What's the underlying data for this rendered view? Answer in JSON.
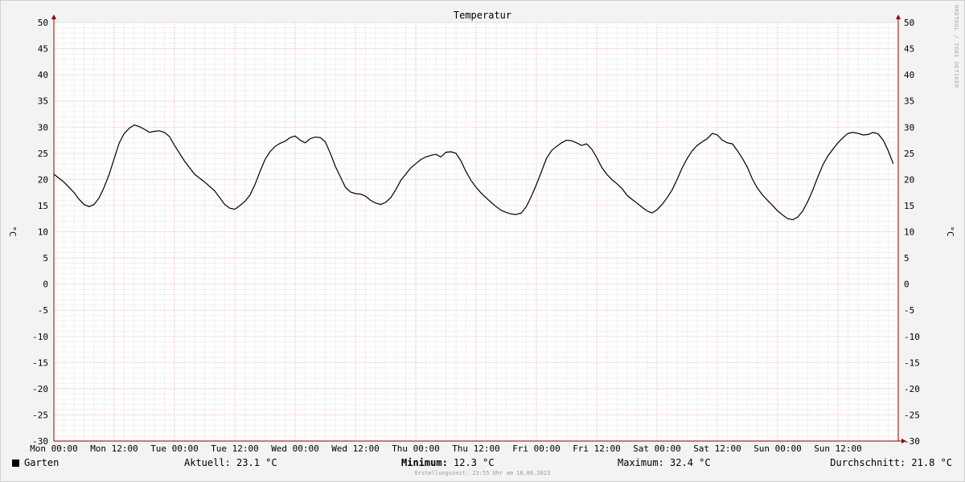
{
  "chart_data": {
    "type": "line",
    "title": "Temperatur",
    "ylabel": "°C",
    "ylim": [
      -30,
      50
    ],
    "y_ticks": [
      "50",
      "45",
      "40",
      "35",
      "30",
      "25",
      "20",
      "15",
      "10",
      "5",
      "0",
      "-5",
      "-10",
      "-15",
      "-20",
      "-25",
      "-30"
    ],
    "x_ticks": [
      "Mon 00:00",
      "Mon 12:00",
      "Tue 00:00",
      "Tue 12:00",
      "Wed 00:00",
      "Wed 12:00",
      "Thu 00:00",
      "Thu 12:00",
      "Fri 00:00",
      "Fri 12:00",
      "Sat 00:00",
      "Sat 12:00",
      "Sun 00:00",
      "Sun 12:00"
    ],
    "x_range_hours": [
      0,
      168
    ],
    "grid": true,
    "series": [
      {
        "name": "Garten",
        "color": "#000000",
        "points": [
          [
            0,
            21.0
          ],
          [
            2,
            19.5
          ],
          [
            4,
            17.5
          ],
          [
            5,
            16.2
          ],
          [
            6,
            15.2
          ],
          [
            7,
            14.8
          ],
          [
            8,
            15.2
          ],
          [
            9,
            16.5
          ],
          [
            10,
            18.5
          ],
          [
            11,
            21.0
          ],
          [
            12,
            24.0
          ],
          [
            13,
            27.0
          ],
          [
            14,
            28.8
          ],
          [
            15,
            29.8
          ],
          [
            16,
            30.4
          ],
          [
            17,
            30.1
          ],
          [
            18,
            29.6
          ],
          [
            19,
            29.0
          ],
          [
            20,
            29.2
          ],
          [
            21,
            29.3
          ],
          [
            22,
            29.0
          ],
          [
            23,
            28.2
          ],
          [
            24,
            26.5
          ],
          [
            26,
            23.5
          ],
          [
            28,
            21.0
          ],
          [
            30,
            19.5
          ],
          [
            32,
            17.8
          ],
          [
            33,
            16.5
          ],
          [
            34,
            15.2
          ],
          [
            35,
            14.5
          ],
          [
            36,
            14.3
          ],
          [
            37,
            15.0
          ],
          [
            38,
            15.8
          ],
          [
            39,
            17.0
          ],
          [
            40,
            19.0
          ],
          [
            41,
            21.5
          ],
          [
            42,
            23.8
          ],
          [
            43,
            25.3
          ],
          [
            44,
            26.3
          ],
          [
            45,
            26.9
          ],
          [
            46,
            27.3
          ],
          [
            47,
            28.0
          ],
          [
            48,
            28.3
          ],
          [
            49,
            27.5
          ],
          [
            50,
            27.0
          ],
          [
            51,
            27.8
          ],
          [
            52,
            28.1
          ],
          [
            53,
            28.0
          ],
          [
            54,
            27.2
          ],
          [
            55,
            25.0
          ],
          [
            56,
            22.5
          ],
          [
            57,
            20.5
          ],
          [
            58,
            18.5
          ],
          [
            59,
            17.6
          ],
          [
            60,
            17.3
          ],
          [
            61,
            17.2
          ],
          [
            62,
            16.8
          ],
          [
            63,
            16.0
          ],
          [
            64,
            15.5
          ],
          [
            65,
            15.2
          ],
          [
            66,
            15.6
          ],
          [
            67,
            16.5
          ],
          [
            68,
            18.0
          ],
          [
            69,
            19.8
          ],
          [
            70,
            21.0
          ],
          [
            71,
            22.2
          ],
          [
            72,
            23.0
          ],
          [
            73,
            23.8
          ],
          [
            74,
            24.3
          ],
          [
            75,
            24.6
          ],
          [
            76,
            24.8
          ],
          [
            77,
            24.3
          ],
          [
            78,
            25.2
          ],
          [
            79,
            25.3
          ],
          [
            80,
            25.0
          ],
          [
            81,
            23.5
          ],
          [
            82,
            21.5
          ],
          [
            83,
            19.8
          ],
          [
            84,
            18.5
          ],
          [
            85,
            17.4
          ],
          [
            86,
            16.5
          ],
          [
            87,
            15.6
          ],
          [
            88,
            14.8
          ],
          [
            89,
            14.1
          ],
          [
            90,
            13.7
          ],
          [
            91,
            13.4
          ],
          [
            92,
            13.3
          ],
          [
            93,
            13.6
          ],
          [
            94,
            14.8
          ],
          [
            95,
            16.8
          ],
          [
            96,
            19.0
          ],
          [
            97,
            21.5
          ],
          [
            98,
            24.0
          ],
          [
            99,
            25.5
          ],
          [
            100,
            26.3
          ],
          [
            101,
            27.0
          ],
          [
            102,
            27.5
          ],
          [
            103,
            27.4
          ],
          [
            104,
            27.0
          ],
          [
            105,
            26.5
          ],
          [
            106,
            26.8
          ],
          [
            107,
            25.8
          ],
          [
            108,
            24.2
          ],
          [
            109,
            22.3
          ],
          [
            110,
            21.0
          ],
          [
            111,
            20.0
          ],
          [
            112,
            19.2
          ],
          [
            113,
            18.3
          ],
          [
            114,
            17.0
          ],
          [
            115,
            16.2
          ],
          [
            116,
            15.5
          ],
          [
            117,
            14.7
          ],
          [
            118,
            14.0
          ],
          [
            119,
            13.6
          ],
          [
            120,
            14.2
          ],
          [
            121,
            15.2
          ],
          [
            122,
            16.5
          ],
          [
            123,
            18.0
          ],
          [
            124,
            20.0
          ],
          [
            125,
            22.2
          ],
          [
            126,
            24.0
          ],
          [
            127,
            25.5
          ],
          [
            128,
            26.5
          ],
          [
            129,
            27.2
          ],
          [
            130,
            27.8
          ],
          [
            131,
            28.8
          ],
          [
            132,
            28.5
          ],
          [
            133,
            27.5
          ],
          [
            134,
            27.0
          ],
          [
            135,
            26.8
          ],
          [
            136,
            25.5
          ],
          [
            137,
            24.0
          ],
          [
            138,
            22.3
          ],
          [
            139,
            20.0
          ],
          [
            140,
            18.3
          ],
          [
            141,
            17.0
          ],
          [
            142,
            16.0
          ],
          [
            143,
            15.0
          ],
          [
            144,
            14.0
          ],
          [
            145,
            13.2
          ],
          [
            146,
            12.5
          ],
          [
            147,
            12.3
          ],
          [
            148,
            12.8
          ],
          [
            149,
            14.0
          ],
          [
            150,
            15.8
          ],
          [
            151,
            18.0
          ],
          [
            152,
            20.5
          ],
          [
            153,
            22.8
          ],
          [
            154,
            24.5
          ],
          [
            155,
            25.8
          ],
          [
            156,
            27.0
          ],
          [
            157,
            28.0
          ],
          [
            158,
            28.8
          ],
          [
            159,
            29.0
          ],
          [
            160,
            28.8
          ],
          [
            161,
            28.5
          ],
          [
            162,
            28.6
          ],
          [
            163,
            29.0
          ],
          [
            164,
            28.7
          ],
          [
            165,
            27.5
          ],
          [
            166,
            25.5
          ],
          [
            167,
            23.0
          ]
        ]
      }
    ]
  },
  "legend": {
    "series_label": "Garten",
    "current": "Aktuell: 23.1 °C",
    "minimum_label": "Minimum:",
    "minimum_value": "12.3 °C",
    "maximum": "Maximum: 32.4 °C",
    "average": "Durchschnitt: 21.8 °C"
  },
  "footer": {
    "credit": "Erstellungszeit: 23:55 Uhr am 18.06.2023",
    "watermark": "RRDTOOL / TOBI OETIKER"
  },
  "colors": {
    "minor_grid": "#e3e3e3",
    "major_grid": "#f3b8bf",
    "axis": "#900000",
    "line": "#000000"
  }
}
